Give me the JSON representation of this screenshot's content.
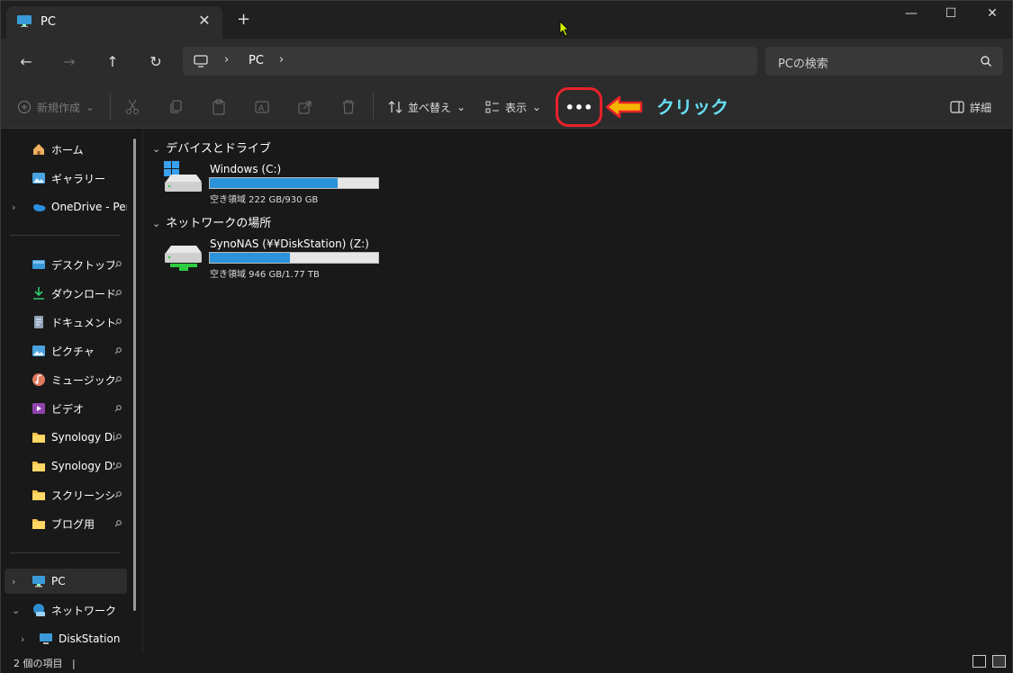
{
  "window": {
    "tab_title": "PC",
    "new_tab": "+",
    "minimize": "—",
    "maximize": "☐",
    "close": "✕",
    "tab_close": "✕"
  },
  "nav": {
    "back": "←",
    "forward": "→",
    "up": "↑",
    "refresh": "↻",
    "breadcrumb": [
      "PC"
    ],
    "chevron": "›",
    "search_placeholder": "PCの検索"
  },
  "toolbar": {
    "new_label": "新規作成",
    "sort_label": "並べ替え",
    "view_label": "表示",
    "more_label": "•••",
    "details_label": "詳細",
    "annotation_text": "クリック",
    "dropdown_chevron": "⌄"
  },
  "sidebar": {
    "quick": [
      {
        "label": "ホーム",
        "icon": "home-icon"
      },
      {
        "label": "ギャラリー",
        "icon": "gallery-icon"
      },
      {
        "label": "OneDrive - Personal",
        "icon": "onedrive-icon",
        "expandable": true
      }
    ],
    "pinned": [
      {
        "label": "デスクトップ",
        "icon": "desktop-icon"
      },
      {
        "label": "ダウンロード",
        "icon": "download-icon"
      },
      {
        "label": "ドキュメント",
        "icon": "documents-icon"
      },
      {
        "label": "ピクチャ",
        "icon": "pictures-icon"
      },
      {
        "label": "ミュージック",
        "icon": "music-icon"
      },
      {
        "label": "ビデオ",
        "icon": "videos-icon"
      },
      {
        "label": "Synology Dis",
        "icon": "folder-icon"
      },
      {
        "label": "Synology DS",
        "icon": "folder-icon"
      },
      {
        "label": "スクリーンショット",
        "icon": "folder-icon"
      },
      {
        "label": "ブログ用",
        "icon": "folder-icon"
      }
    ],
    "tree": [
      {
        "label": "PC",
        "icon": "pc-icon",
        "selected": true
      },
      {
        "label": "ネットワーク",
        "icon": "network-icon",
        "expanded": true
      },
      {
        "label": "DiskStation",
        "icon": "computer-icon"
      }
    ]
  },
  "main": {
    "group1": "デバイスとドライブ",
    "group2": "ネットワークの場所",
    "drives": [
      {
        "name": "Windows (C:)",
        "free_text": "空き領域 222 GB/930 GB",
        "used_fraction": 0.761
      },
      {
        "name": "SynoNAS (¥¥DiskStation) (Z:)",
        "free_text": "空き領域 946 GB/1.77 TB",
        "used_fraction": 0.478
      }
    ]
  },
  "status": {
    "count_text": "2 個の項目",
    "separator": "|"
  },
  "colors": {
    "accent": "#2b93d9",
    "highlight_ring": "#e8222a",
    "annotation_text": "#67e0f2",
    "arrow_fill": "#f4b400"
  }
}
